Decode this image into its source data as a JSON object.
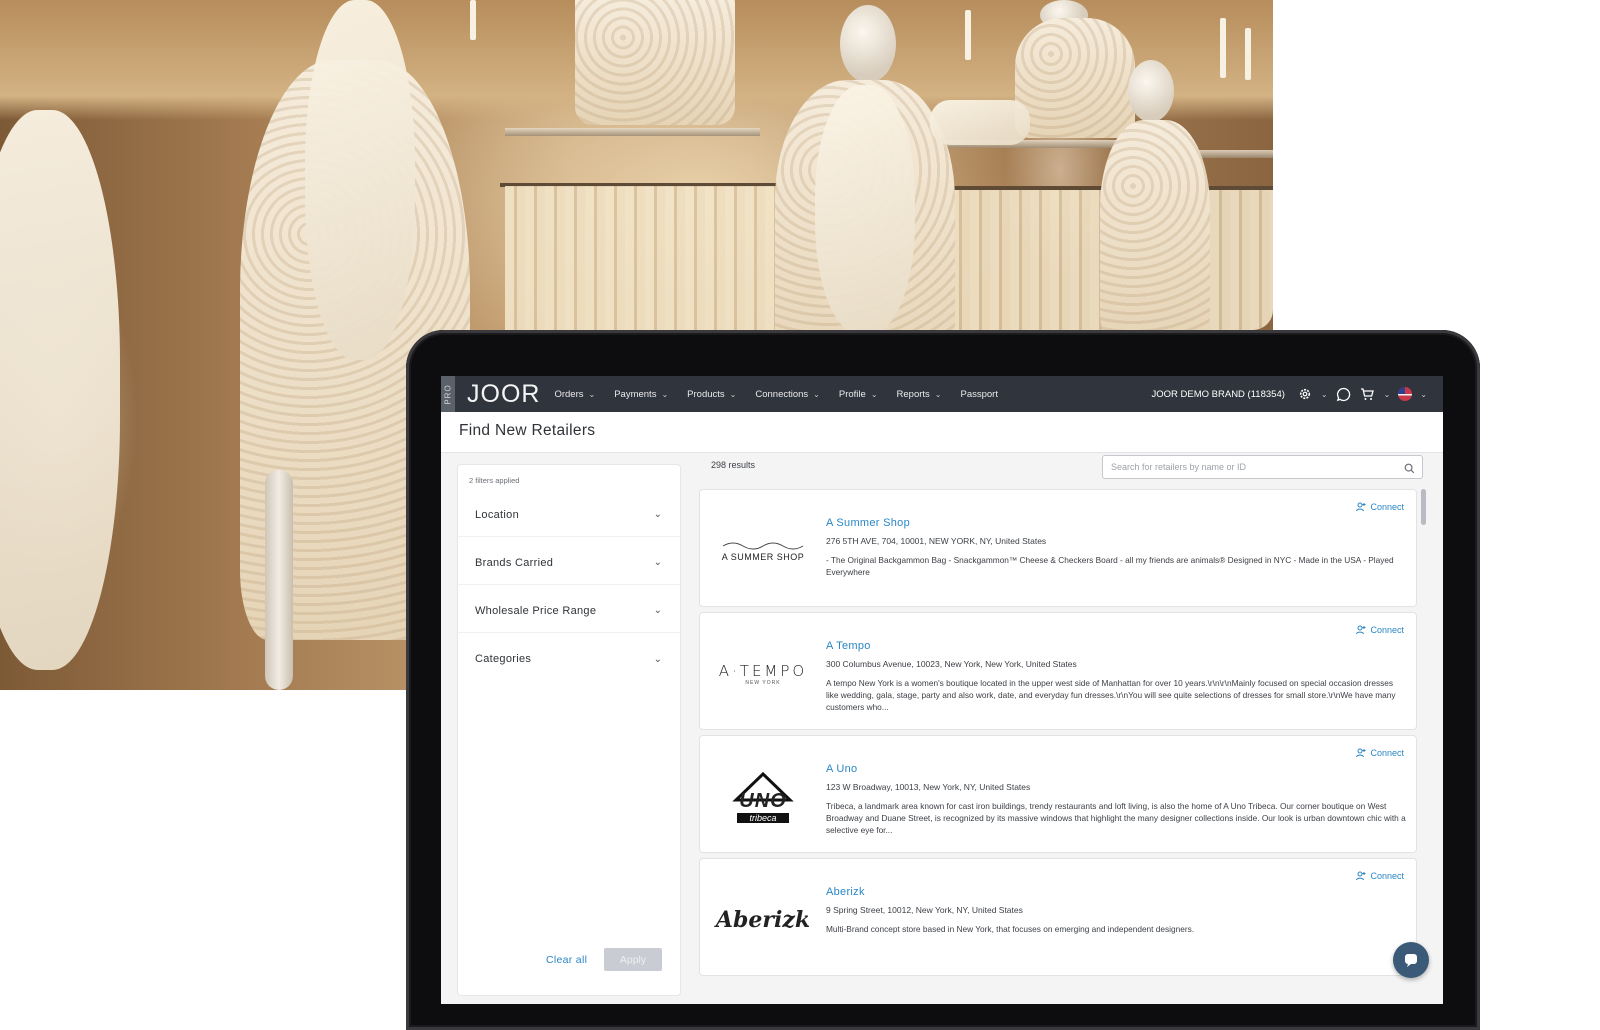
{
  "nav": {
    "pro_badge": "PRO",
    "logo": "JOOR",
    "items": [
      {
        "label": "Orders",
        "has_dropdown": true
      },
      {
        "label": "Payments",
        "has_dropdown": true
      },
      {
        "label": "Products",
        "has_dropdown": true
      },
      {
        "label": "Connections",
        "has_dropdown": true
      },
      {
        "label": "Profile",
        "has_dropdown": true
      },
      {
        "label": "Reports",
        "has_dropdown": true
      },
      {
        "label": "Passport",
        "has_dropdown": false
      }
    ],
    "account": "JOOR DEMO BRAND (118354)",
    "icons": [
      "gear-icon",
      "chat-icon",
      "cart-icon",
      "flag-icon"
    ]
  },
  "page": {
    "title": "Find New Retailers"
  },
  "filters": {
    "applied": "2 filters applied",
    "items": [
      {
        "label": "Location"
      },
      {
        "label": "Brands Carried"
      },
      {
        "label": "Wholesale Price Range"
      },
      {
        "label": "Categories"
      }
    ],
    "clear_label": "Clear all",
    "apply_label": "Apply"
  },
  "search": {
    "results_count": "298 results",
    "placeholder": "Search for retailers by name or ID"
  },
  "results": [
    {
      "name": "A Summer Shop",
      "address": "276 5TH AVE, 704, 10001, NEW YORK, NY, United States",
      "description": "- The Original Backgammon Bag - Snackgammon™ Cheese & Checkers Board - all my friends are animals® Designed in NYC - Made in the USA - Played Everywhere",
      "logo_text": "A SUMMER SHOP",
      "connect_label": "Connect"
    },
    {
      "name": "A Tempo",
      "address": "300 Columbus Avenue, 10023, New York, New York, United States",
      "description": "A tempo New York is a women's boutique located in the upper west side of Manhattan for over 10 years.\\r\\n\\r\\nMainly focused on special occasion dresses like wedding, gala, stage, party and also work, date, and everyday fun dresses.\\r\\nYou will see quite selections of dresses for small store.\\r\\nWe have many customers who...",
      "logo_text": "A·TEMPO",
      "logo_sub": "NEW YORK",
      "connect_label": "Connect"
    },
    {
      "name": "A Uno",
      "address": "123 W Broadway, 10013, New York, NY, United States",
      "description": "Tribeca, a landmark area known for cast iron buildings, trendy restaurants and loft living, is also the home of A Uno Tribeca. Our corner boutique on West Broadway and Duane Street, is recognized by its massive windows that highlight the many designer collections inside. Our look is urban downtown chic with a selective eye for...",
      "logo_text": "UNO",
      "logo_sub": "tribeca",
      "connect_label": "Connect"
    },
    {
      "name": "Aberizk",
      "address": "9 Spring Street, 10012, New York, NY, United States",
      "description": "Multi-Brand concept store based in New York, that focuses on emerging and independent designers.",
      "logo_text": "Aberizk",
      "connect_label": "Connect"
    }
  ],
  "colors": {
    "nav_bg": "#30343c",
    "link_blue": "#2a86c6",
    "apply_disabled": "#c9ccd2"
  }
}
